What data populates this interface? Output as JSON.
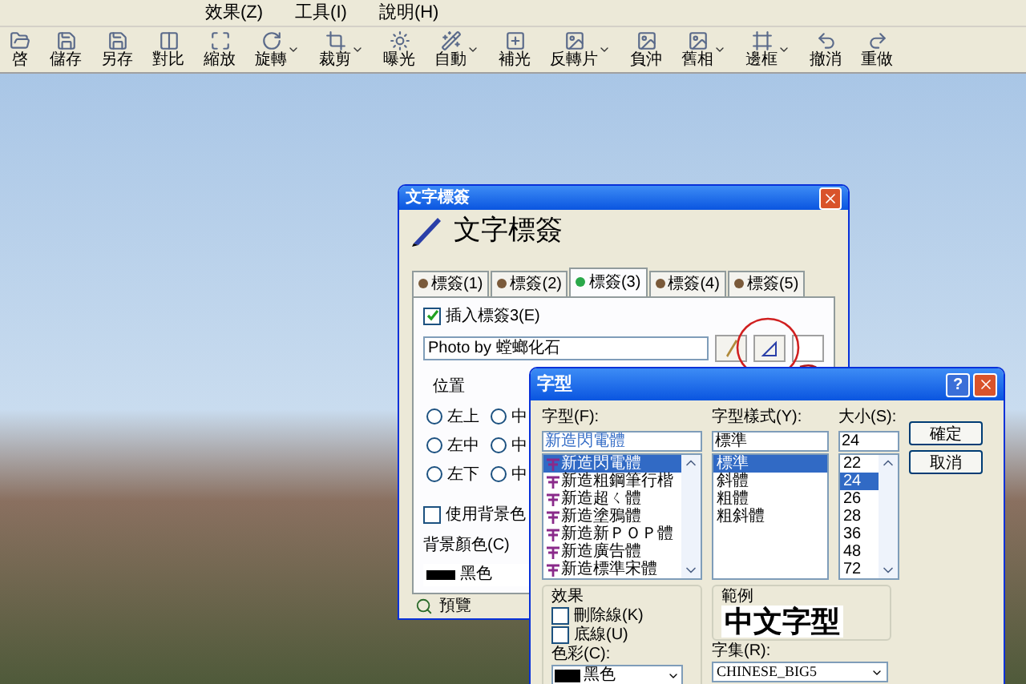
{
  "menu": [
    {
      "label": "效果(Z)"
    },
    {
      "label": "工具(I)"
    },
    {
      "label": "說明(H)"
    }
  ],
  "toolbar": [
    {
      "label": "啓",
      "dropdown": false
    },
    {
      "label": "儲存",
      "dropdown": false
    },
    {
      "label": "另存",
      "dropdown": false
    },
    {
      "label": "對比",
      "dropdown": false
    },
    {
      "label": "縮放",
      "dropdown": false
    },
    {
      "label": "旋轉",
      "dropdown": true
    },
    {
      "label": "裁剪",
      "dropdown": true
    },
    {
      "label": "曝光",
      "dropdown": false
    },
    {
      "label": "自動",
      "dropdown": true
    },
    {
      "label": "補光",
      "dropdown": false
    },
    {
      "label": "反轉片",
      "dropdown": true
    },
    {
      "label": "負沖",
      "dropdown": false
    },
    {
      "label": "舊相",
      "dropdown": true
    },
    {
      "label": "邊框",
      "dropdown": true
    },
    {
      "label": "撤消",
      "dropdown": false
    },
    {
      "label": "重做",
      "dropdown": false
    }
  ],
  "label_dialog": {
    "title": "文字標簽",
    "heading": "文字標簽",
    "tabs": [
      {
        "label": "標簽(1)",
        "selected": false
      },
      {
        "label": "標簽(2)",
        "selected": false
      },
      {
        "label": "標簽(3)",
        "selected": true
      },
      {
        "label": "標簽(4)",
        "selected": false
      },
      {
        "label": "標簽(5)",
        "selected": false
      }
    ],
    "insert": {
      "label": "插入標簽3(E)",
      "checked": true
    },
    "text_value": "Photo by 螳螂化石",
    "position": {
      "title": "位置",
      "options": [
        {
          "label": "左上",
          "selected": false
        },
        {
          "label": "中",
          "selected": false
        },
        {
          "label": "左中",
          "selected": false
        },
        {
          "label": "中",
          "selected": false
        },
        {
          "label": "左下",
          "selected": false
        },
        {
          "label": "中",
          "selected": false
        }
      ]
    },
    "use_background": {
      "label": "使用背景色",
      "checked": false
    },
    "background_color": {
      "label": "背景顏色(C)",
      "value": "黑色",
      "color": "#000000"
    },
    "preview": "預覽"
  },
  "font_dialog": {
    "title": "字型",
    "help": "?",
    "font": {
      "label": "字型(F):",
      "value": "新造閃電體",
      "items": [
        {
          "label": "新造閃電體",
          "selected": true
        },
        {
          "label": "新造粗鋼筆行楷",
          "selected": false
        },
        {
          "label": "新造超ㄑ體",
          "selected": false
        },
        {
          "label": "新造塗鴉體",
          "selected": false
        },
        {
          "label": "新造新ＰＯＰ體",
          "selected": false
        },
        {
          "label": "新造廣告體",
          "selected": false
        },
        {
          "label": "新造標準宋體",
          "selected": false
        }
      ]
    },
    "style": {
      "label": "字型樣式(Y):",
      "value": "標準",
      "items": [
        {
          "label": "標準",
          "selected": true
        },
        {
          "label": "斜體",
          "selected": false
        },
        {
          "label": "粗體",
          "selected": false
        },
        {
          "label": "粗斜體",
          "selected": false
        }
      ]
    },
    "size": {
      "label": "大小(S):",
      "value": "24",
      "items": [
        {
          "label": "22",
          "selected": false
        },
        {
          "label": "24",
          "selected": true
        },
        {
          "label": "26",
          "selected": false
        },
        {
          "label": "28",
          "selected": false
        },
        {
          "label": "36",
          "selected": false
        },
        {
          "label": "48",
          "selected": false
        },
        {
          "label": "72",
          "selected": false
        }
      ]
    },
    "buttons": [
      "確定",
      "取消"
    ],
    "effects": {
      "title": "效果",
      "options": [
        {
          "label": "刪除線(K)",
          "checked": false
        },
        {
          "label": "底線(U)",
          "checked": false
        }
      ],
      "color_label": "色彩(C):",
      "color_value": "黑色",
      "color": "#000000"
    },
    "sample": {
      "title": "範例",
      "text": "中文字型"
    },
    "charset": {
      "label": "字集(R):",
      "value": "CHINESE_BIG5"
    }
  }
}
